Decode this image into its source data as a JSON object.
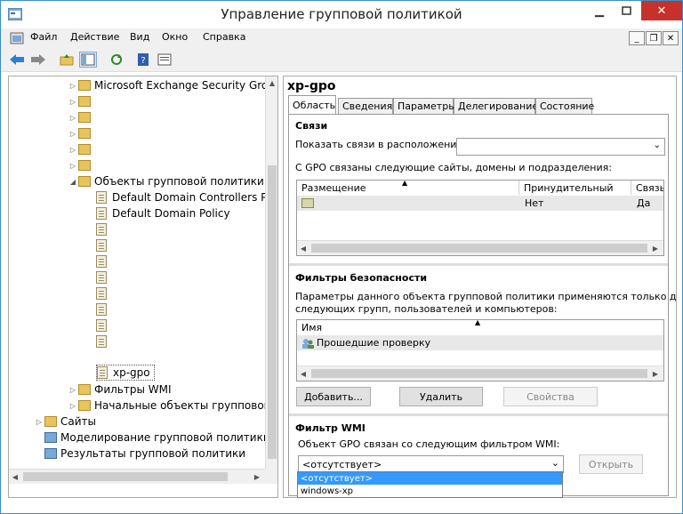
{
  "window": {
    "title": "Управление групповой политикой"
  },
  "menu": {
    "items": [
      "Файл",
      "Действие",
      "Вид",
      "Окно",
      "Справка"
    ]
  },
  "tree": {
    "items": [
      {
        "label": "Microsoft Exchange Security Group",
        "type": "folder"
      },
      {
        "label": "",
        "type": "folder"
      },
      {
        "label": "",
        "type": "folder"
      },
      {
        "label": "",
        "type": "folder"
      },
      {
        "label": "",
        "type": "folder"
      },
      {
        "label": "",
        "type": "folder"
      },
      {
        "label": "Объекты групповой политики",
        "type": "folder"
      },
      {
        "label": "Default Domain Controllers Pol",
        "type": "gpo"
      },
      {
        "label": "Default Domain Policy",
        "type": "gpo"
      },
      {
        "label": "",
        "type": "gpo"
      },
      {
        "label": "",
        "type": "gpo"
      },
      {
        "label": "",
        "type": "gpo"
      },
      {
        "label": "",
        "type": "gpo"
      },
      {
        "label": "",
        "type": "gpo"
      },
      {
        "label": "",
        "type": "gpo"
      },
      {
        "label": "",
        "type": "gpo"
      },
      {
        "label": "",
        "type": "gpo"
      },
      {
        "label": "xp-gpo",
        "type": "gpo"
      },
      {
        "label": "Фильтры WMI",
        "type": "folder"
      },
      {
        "label": "Начальные объекты групповой п",
        "type": "folder"
      },
      {
        "label": "Сайты",
        "type": "folder"
      },
      {
        "label": "Моделирование групповой политики",
        "type": "folder"
      },
      {
        "label": "Результаты групповой политики",
        "type": "folder"
      }
    ]
  },
  "details": {
    "title": "xp-gpo",
    "tabs": [
      "Область",
      "Сведения",
      "Параметры",
      "Делегирование",
      "Состояние"
    ],
    "links": {
      "heading": "Связи",
      "show_label": "Показать связи в расположении:",
      "linked_label": "С GPO связаны следующие сайты, домены и подразделения:",
      "columns": [
        "Размещение",
        "Принудительный",
        "Связь"
      ],
      "row": {
        "location": "",
        "enforced": "Нет",
        "link": "Да"
      }
    },
    "security": {
      "heading": "Фильтры безопасности",
      "desc_line1": "Параметры данного объекта групповой политики применяются только для",
      "desc_line2": "следующих групп, пользователей и компьютеров:",
      "column": "Имя",
      "row": "Прошедшие проверку",
      "add": "Добавить...",
      "remove": "Удалить",
      "properties": "Свойства"
    },
    "wmi": {
      "heading": "Фильтр WMI",
      "label": "Объект GPO связан со следующим фильтром WMI:",
      "selected": "<отсутствует>",
      "open": "Открыть",
      "options": [
        "<отсутствует>",
        "windows-xp"
      ]
    }
  },
  "colors": {
    "selection": "#3399ff",
    "border": "#3c8fc7",
    "folder": "#e9c45d"
  }
}
